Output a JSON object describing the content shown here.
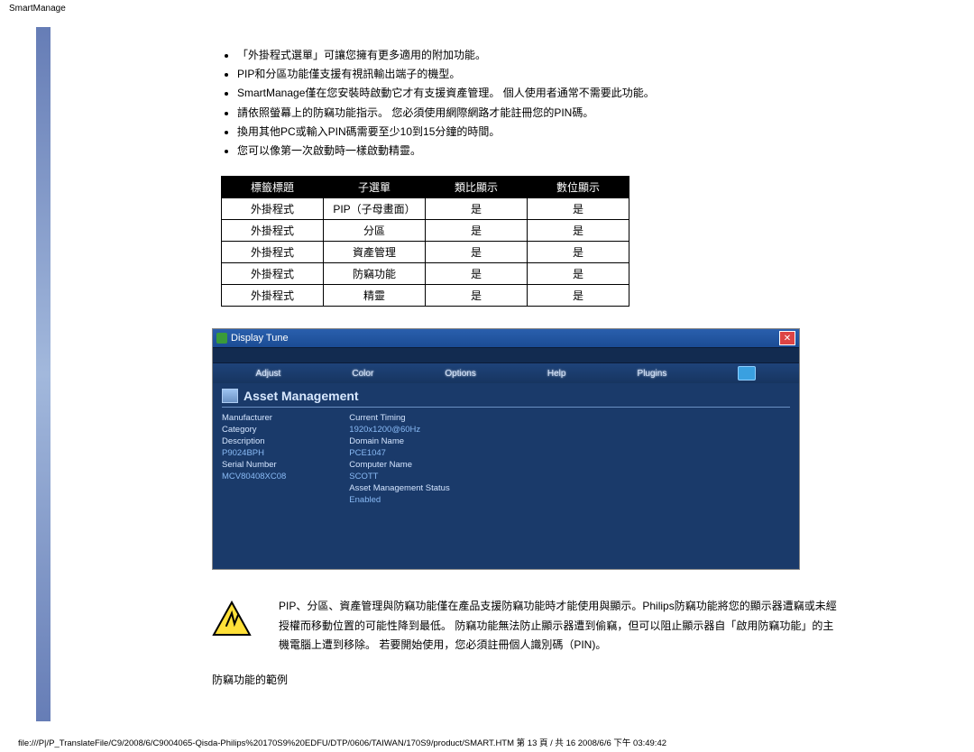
{
  "page_title": "SmartManage",
  "bullets": [
    "「外掛程式選單」可讓您擁有更多適用的附加功能。",
    "PIP和分區功能僅支援有視訊輸出端子的機型。",
    "SmartManage僅在您安裝時啟動它才有支援資產管理。 個人使用者通常不需要此功能。",
    "請依照螢幕上的防竊功能指示。 您必須使用網際網路才能註冊您的PIN碼。",
    "換用其他PC或輸入PIN碼需要至少10到15分鐘的時間。",
    "您可以像第一次啟動時一樣啟動精靈。"
  ],
  "table": {
    "headers": [
      "標籤標題",
      "子選單",
      "類比顯示",
      "數位顯示"
    ],
    "rows": [
      [
        "外掛程式",
        "PIP（子母畫面）",
        "是",
        "是"
      ],
      [
        "外掛程式",
        "分區",
        "是",
        "是"
      ],
      [
        "外掛程式",
        "資產管理",
        "是",
        "是"
      ],
      [
        "外掛程式",
        "防竊功能",
        "是",
        "是"
      ],
      [
        "外掛程式",
        "精靈",
        "是",
        "是"
      ]
    ]
  },
  "shot": {
    "window_title": "Display Tune",
    "close_glyph": "✕",
    "tabs": [
      "Adjust",
      "Color",
      "Options",
      "Help",
      "Plugins"
    ],
    "panel_title": "Asset Management",
    "left_fields": [
      {
        "lbl": "Manufacturer",
        "val": ""
      },
      {
        "lbl": "Category",
        "val": ""
      },
      {
        "lbl": "Description",
        "val": ""
      },
      {
        "lbl": "P9024BPH",
        "val": ""
      },
      {
        "lbl": "Serial Number",
        "val": ""
      },
      {
        "lbl": "MCV80408XC08",
        "val": ""
      }
    ],
    "right_fields": [
      {
        "lbl": "Current Timing",
        "val": ""
      },
      {
        "lbl": "1920x1200@60Hz",
        "val": ""
      },
      {
        "lbl": "Domain Name",
        "val": ""
      },
      {
        "lbl": "PCE1047",
        "val": ""
      },
      {
        "lbl": "Computer Name",
        "val": ""
      },
      {
        "lbl": "SCOTT",
        "val": ""
      },
      {
        "lbl": "Asset Management Status",
        "val": ""
      },
      {
        "lbl": "Enabled",
        "val": ""
      }
    ]
  },
  "warning_text": "PIP、分區、資產管理與防竊功能僅在產品支援防竊功能時才能使用與顯示。Philips防竊功能將您的顯示器遭竊或未經授權而移動位置的可能性降到最低。 防竊功能無法防止顯示器遭到偷竊，但可以阻止顯示器自「啟用防竊功能」的主機電腦上遭到移除。 若要開始使用，您必須註冊個人識別碼（PIN)。",
  "example_heading": "防竊功能的範例",
  "footer": "file:///P|/P_TranslateFile/C9/2008/6/C9004065-Qisda-Philips%20170S9%20EDFU/DTP/0606/TAIWAN/170S9/product/SMART.HTM 第 13 頁 / 共 16 2008/6/6 下午 03:49:42"
}
